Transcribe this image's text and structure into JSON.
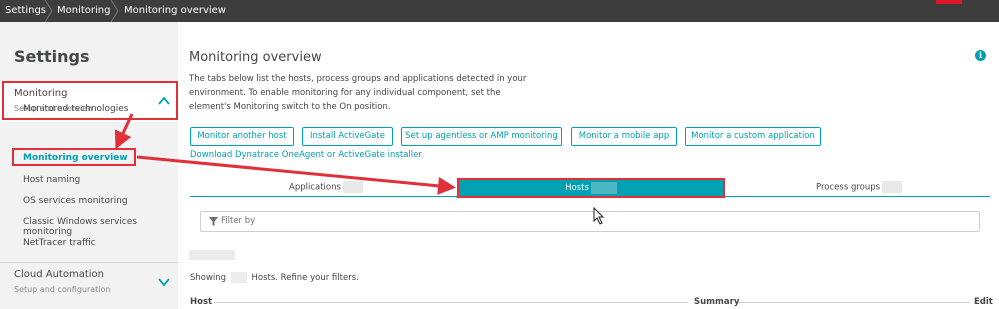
{
  "breadcrumb": {
    "items": [
      "Settings",
      "Monitoring",
      "Monitoring overview"
    ]
  },
  "sidebar": {
    "title": "Settings",
    "sections": [
      {
        "name": "Monitoring",
        "subtitle": "Setup and overview",
        "expanded": true,
        "icon": "chevron-up-icon"
      },
      {
        "name": "Cloud Automation",
        "subtitle": "Setup and configuration",
        "expanded": false,
        "icon": "chevron-down-icon"
      }
    ],
    "items": [
      "Monitored technologies",
      "Monitoring overview",
      "Host naming",
      "OS services monitoring",
      "Classic Windows services monitoring",
      "NetTracer traffic"
    ],
    "active_item": "Monitoring overview"
  },
  "main": {
    "title": "Monitoring overview",
    "description": "The tabs below list the hosts, process groups and applications detected in your environment. To enable monitoring for any individual component, set the element's Monitoring switch to the On position.",
    "buttons": [
      "Monitor another host",
      "Install ActiveGate",
      "Set up agentless or AMP monitoring",
      "Monitor a mobile app",
      "Monitor a custom application"
    ],
    "download_link": "Download Dynatrace OneAgent or ActiveGate installer",
    "tabs": [
      {
        "label": "Applications",
        "active": false
      },
      {
        "label": "Hosts",
        "active": true
      },
      {
        "label": "Process groups",
        "active": false
      }
    ],
    "filter_placeholder": "Filter by",
    "showing_prefix": "Showing",
    "showing_suffix": "Hosts. Refine your filters.",
    "columns": [
      "Host",
      "Summary",
      "Edit"
    ]
  },
  "colors": {
    "accent": "#00a1b2",
    "topbar": "#3d3d3d",
    "annotation": "#e0313b",
    "sidebar_bg": "#f2f2f2"
  },
  "icons": [
    "info-icon",
    "filter-icon",
    "chevron-up-icon",
    "chevron-down-icon",
    "mouse-cursor-icon"
  ]
}
